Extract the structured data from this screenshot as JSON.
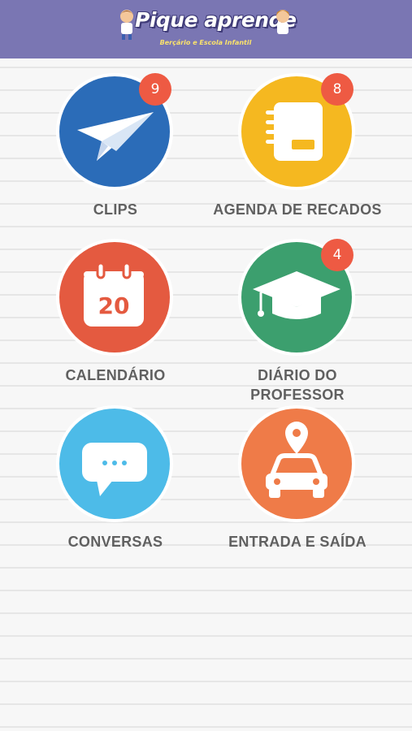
{
  "header": {
    "logo_title": "Pique aprende",
    "logo_subtitle": "Berçário e Escola Infantil",
    "colors": {
      "background": "#7a76b3"
    }
  },
  "menu": [
    {
      "key": "clips",
      "label_lines": [
        "CLIPS"
      ],
      "badge": "9",
      "icon": "paper-plane-icon",
      "color": "#2b6cb8"
    },
    {
      "key": "agenda",
      "label_lines": [
        "AGENDA DE RECADOS"
      ],
      "badge": "8",
      "icon": "notebook-icon",
      "color": "#f5b820"
    },
    {
      "key": "calendario",
      "label_lines": [
        "CALENDÁRIO"
      ],
      "badge": "",
      "icon": "calendar-icon",
      "calendar_day": "20",
      "color": "#e45a40"
    },
    {
      "key": "diario",
      "label_lines": [
        "DIÁRIO DO",
        "PROFESSOR"
      ],
      "badge": "4",
      "icon": "graduation-cap-icon",
      "color": "#3c9f6e"
    },
    {
      "key": "conversas",
      "label_lines": [
        "CONVERSAS"
      ],
      "badge": "",
      "icon": "chat-bubble-icon",
      "color": "#4dbbe8"
    },
    {
      "key": "entrada",
      "label_lines": [
        "ENTRADA E SAÍDA"
      ],
      "badge": "",
      "icon": "car-location-icon",
      "color": "#ef7b48"
    }
  ],
  "colors": {
    "badge": "#ee5a43",
    "label_text": "#606060"
  }
}
